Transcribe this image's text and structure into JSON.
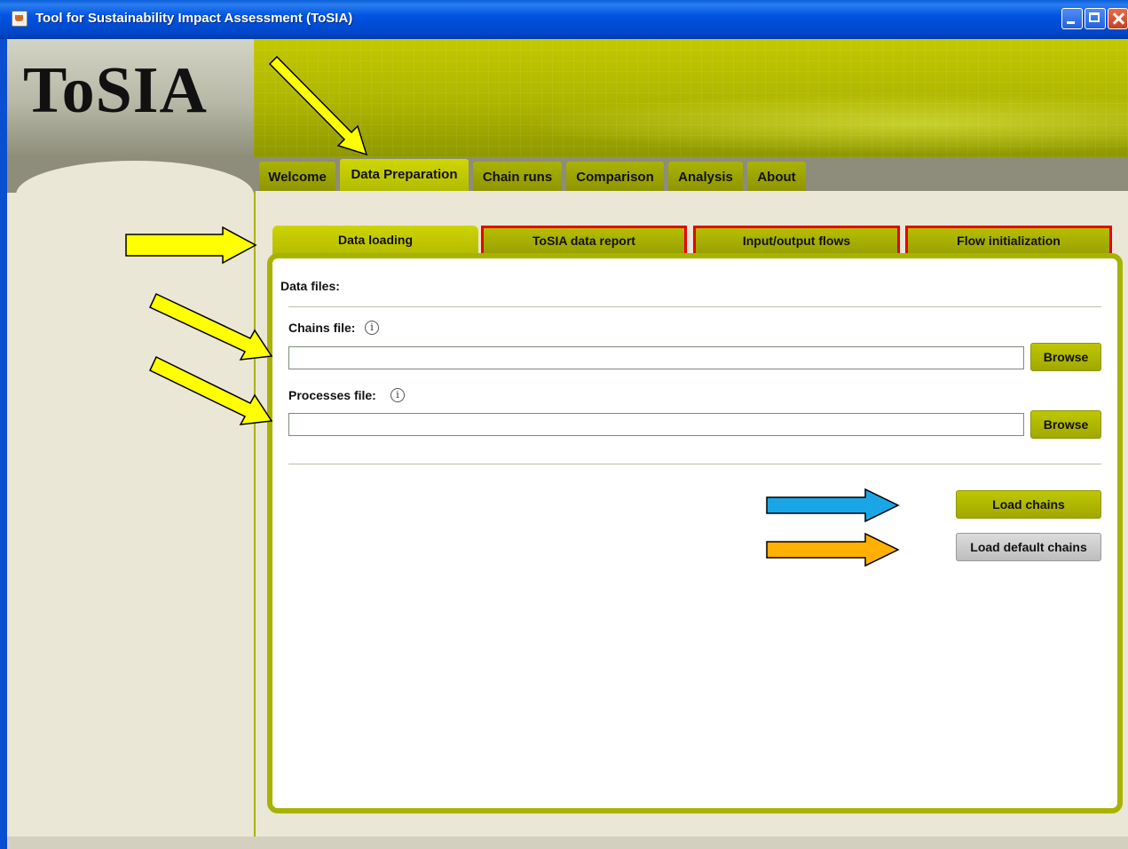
{
  "window": {
    "title": "Tool for Sustainability Impact Assessment (ToSIA)",
    "controls": [
      "minimize",
      "maximize",
      "close"
    ]
  },
  "logo": {
    "text": "ToSIA"
  },
  "main_tabs": [
    {
      "label": "Welcome",
      "active": false
    },
    {
      "label": "Data Preparation",
      "active": true
    },
    {
      "label": "Chain runs",
      "active": false
    },
    {
      "label": "Comparison",
      "active": false
    },
    {
      "label": "Analysis",
      "active": false
    },
    {
      "label": "About",
      "active": false
    }
  ],
  "sub_tabs": [
    {
      "label": "Data loading",
      "active": true,
      "highlighted": false
    },
    {
      "label": "ToSIA data report",
      "active": false,
      "highlighted": true
    },
    {
      "label": "Input/output flows",
      "active": false,
      "highlighted": true
    },
    {
      "label": "Flow initialization",
      "active": false,
      "highlighted": true
    }
  ],
  "data_loading": {
    "section_title": "Data files:",
    "chains_file": {
      "label": "Chains file:",
      "value": "",
      "info_icon": "info-icon",
      "browse_label": "Browse"
    },
    "processes_file": {
      "label": "Processes file:",
      "value": "",
      "info_icon": "info-icon",
      "browse_label": "Browse"
    },
    "load_chains_label": "Load chains",
    "load_default_chains_label": "Load default chains"
  },
  "annotation_colors": {
    "yellow": "#ffff00",
    "blue": "#1aa6e6",
    "orange": "#ffb000",
    "highlight_border": "#e80000"
  },
  "theme": {
    "accent_green": "#b3bb00",
    "banner_green": "#aeb500",
    "titlebar_blue": "#0054e3"
  }
}
